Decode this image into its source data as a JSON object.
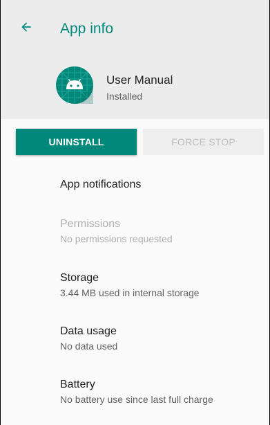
{
  "appbar": {
    "title": "App info",
    "back_icon": "arrow-back-icon"
  },
  "app": {
    "name": "User Manual",
    "status": "Installed",
    "icon": "android-icon"
  },
  "buttons": {
    "uninstall": "UNINSTALL",
    "force_stop": "FORCE STOP"
  },
  "items": [
    {
      "title": "App notifications",
      "subtitle": ""
    },
    {
      "title": "Permissions",
      "subtitle": "No permissions requested"
    },
    {
      "title": "Storage",
      "subtitle": "3.44 MB used in internal storage"
    },
    {
      "title": "Data usage",
      "subtitle": "No data used"
    },
    {
      "title": "Battery",
      "subtitle": "No battery use since last full charge"
    }
  ],
  "colors": {
    "accent": "#00897b",
    "header_bg": "#ececec",
    "background": "#fafafa",
    "disabled_text": "#b0b0b0"
  }
}
